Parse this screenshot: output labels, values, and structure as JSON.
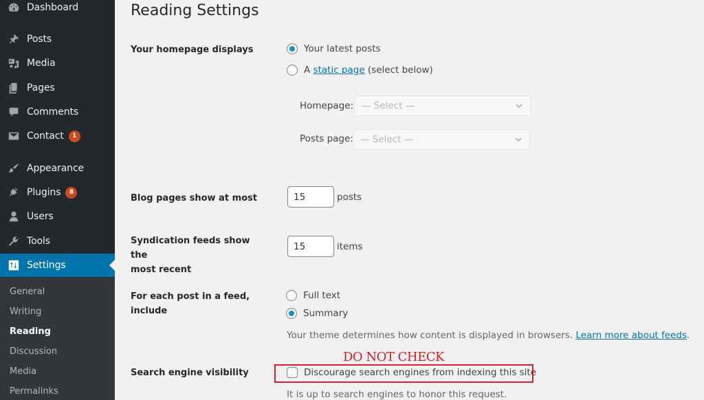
{
  "sidebar": {
    "items": [
      {
        "label": "Dashboard",
        "icon": "dashboard-icon"
      },
      {
        "label": "Posts",
        "icon": "pin-icon"
      },
      {
        "label": "Media",
        "icon": "media-icon"
      },
      {
        "label": "Pages",
        "icon": "pages-icon"
      },
      {
        "label": "Comments",
        "icon": "comment-icon"
      },
      {
        "label": "Contact",
        "icon": "envelope-icon",
        "badge": "1"
      },
      {
        "label": "Appearance",
        "icon": "paintbrush-icon"
      },
      {
        "label": "Plugins",
        "icon": "plug-icon",
        "badge": "8"
      },
      {
        "label": "Users",
        "icon": "user-icon"
      },
      {
        "label": "Tools",
        "icon": "wrench-icon"
      },
      {
        "label": "Settings",
        "icon": "settings-icon",
        "active": true
      }
    ],
    "submenu": [
      {
        "label": "General"
      },
      {
        "label": "Writing"
      },
      {
        "label": "Reading",
        "current": true
      },
      {
        "label": "Discussion"
      },
      {
        "label": "Media"
      },
      {
        "label": "Permalinks"
      }
    ]
  },
  "page": {
    "title": "Reading Settings",
    "homepage_displays": {
      "label": "Your homepage displays",
      "option_latest": "Your latest posts",
      "option_static_prefix": "A",
      "option_static_link": "static page",
      "option_static_suffix": "(select below)",
      "selected": "latest",
      "homepage_label": "Homepage:",
      "homepage_value": "— Select —",
      "posts_page_label": "Posts page:",
      "posts_page_value": "— Select —"
    },
    "blog_pages": {
      "label": "Blog pages show at most",
      "value": "15",
      "unit": "posts"
    },
    "syndication": {
      "label_line1": "Syndication feeds show the",
      "label_line2": "most recent",
      "value": "15",
      "unit": "items"
    },
    "feed_include": {
      "label": "For each post in a feed, include",
      "option_full": "Full text",
      "option_summary": "Summary",
      "selected": "summary",
      "description": "Your theme determines how content is displayed in browsers.",
      "learn_more": "Learn more about feeds",
      "learn_more_suffix": "."
    },
    "search_visibility": {
      "label": "Search engine visibility",
      "checkbox_label": "Discourage search engines from indexing this site",
      "checked": false,
      "description": "It is up to search engines to honor this request."
    },
    "annotation": {
      "text": "DO NOT CHECK",
      "color": "#c8232c"
    }
  },
  "colors": {
    "sidebar_bg": "#23282d",
    "submenu_bg": "#32373c",
    "accent": "#0073aa",
    "badge": "#ca4a1f",
    "page_bg": "#f1f1f1"
  }
}
